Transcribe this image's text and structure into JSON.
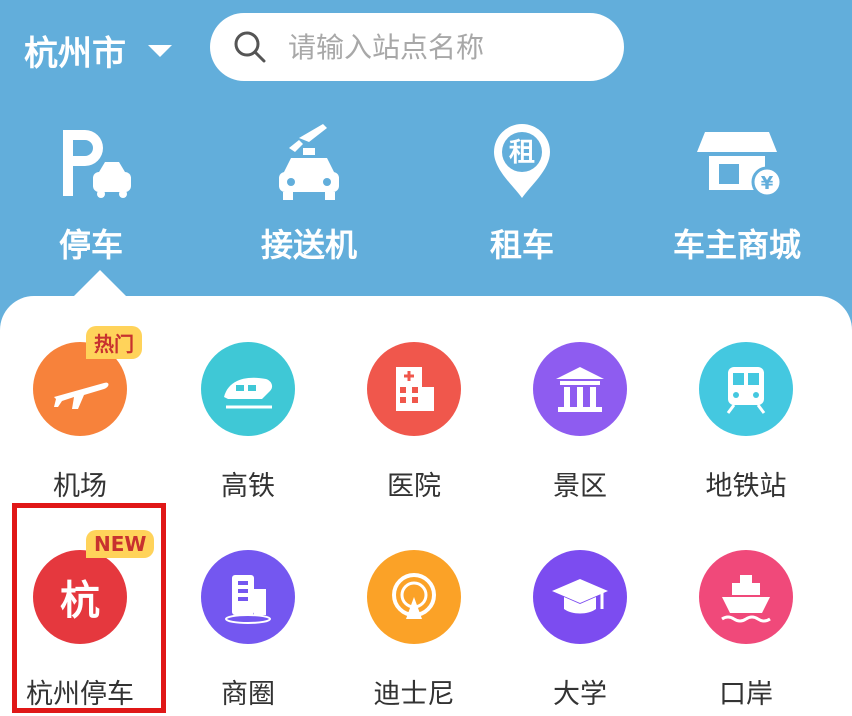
{
  "header": {
    "city": "杭州市",
    "search_placeholder": "请输入站点名称"
  },
  "nav": [
    {
      "label": "停车",
      "icon": "parking-icon"
    },
    {
      "label": "接送机",
      "icon": "airport-taxi-icon"
    },
    {
      "label": "租车",
      "icon": "rent-car-icon"
    },
    {
      "label": "车主商城",
      "icon": "shop-icon"
    }
  ],
  "categories": [
    {
      "label": "机场",
      "icon": "airplane-icon",
      "color": "#f7823b",
      "badge": "热门"
    },
    {
      "label": "高铁",
      "icon": "high-speed-train-icon",
      "color": "#3fc8d6"
    },
    {
      "label": "医院",
      "icon": "hospital-icon",
      "color": "#f0574c"
    },
    {
      "label": "景区",
      "icon": "scenic-temple-icon",
      "color": "#8e5cf0"
    },
    {
      "label": "地铁站",
      "icon": "metro-icon",
      "color": "#44c8e0"
    },
    {
      "label": "杭州停车",
      "icon": "hang-char-icon",
      "color": "#e5383e",
      "badge": "NEW",
      "glyph": "杭"
    },
    {
      "label": "商圈",
      "icon": "business-district-icon",
      "color": "#7457f0"
    },
    {
      "label": "迪士尼",
      "icon": "disney-icon",
      "color": "#fba227"
    },
    {
      "label": "大学",
      "icon": "graduation-cap-icon",
      "color": "#7c4cf0"
    },
    {
      "label": "口岸",
      "icon": "ship-port-icon",
      "color": "#f0497a"
    }
  ]
}
